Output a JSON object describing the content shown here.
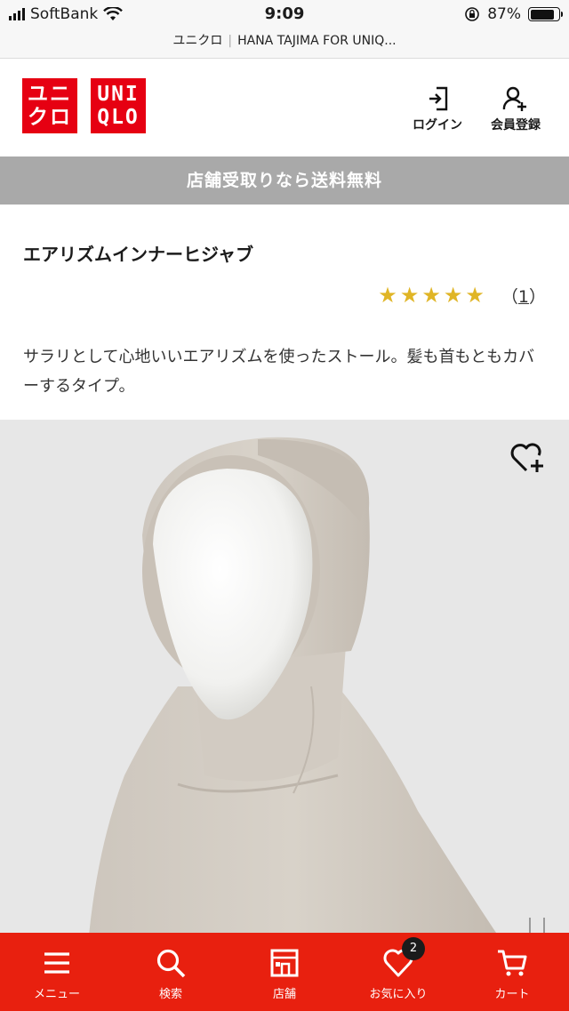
{
  "status_bar": {
    "carrier": "SoftBank",
    "time": "9:09",
    "battery": "87%",
    "battery_level": 0.87
  },
  "url_bar": {
    "site": "ユニクロ",
    "page": "HANA TAJIMA FOR UNIQ..."
  },
  "header": {
    "logo_jp_line1": "ユニ",
    "logo_jp_line2": "クロ",
    "logo_en_line1": "UNI",
    "logo_en_line2": "QLO",
    "login_label": "ログイン",
    "register_label": "会員登録",
    "brand_color": "#e60012"
  },
  "banner": {
    "text": "店舗受取りなら送料無料"
  },
  "product": {
    "name": "エアリズムインナーヒジャブ",
    "stars": "★★★★★",
    "rating": 5,
    "review_count_open": "（",
    "review_count": "1",
    "review_count_close": "）",
    "description": "サラリとして心地いいエアリズムを使ったストール。髪も首もともカバーするタイプ。",
    "favorite_icon": "heart-plus-icon"
  },
  "bottom_nav": {
    "items": [
      {
        "label": "メニュー",
        "icon": "menu-icon"
      },
      {
        "label": "検索",
        "icon": "search-icon"
      },
      {
        "label": "店舗",
        "icon": "store-icon"
      },
      {
        "label": "お気に入り",
        "icon": "heart-icon",
        "badge": "2"
      },
      {
        "label": "カート",
        "icon": "cart-icon"
      }
    ],
    "color": "#e8200f"
  }
}
